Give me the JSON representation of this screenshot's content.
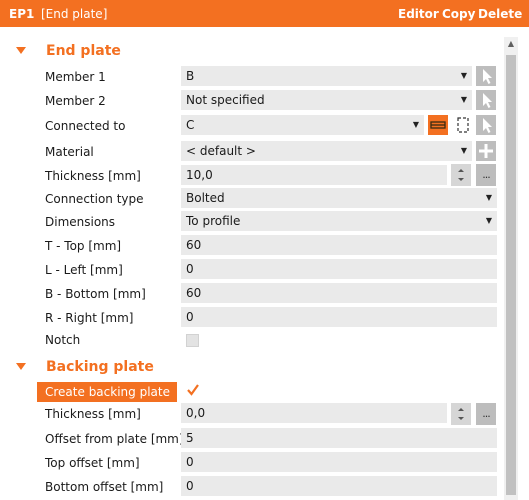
{
  "header": {
    "code": "EP1",
    "name": "[End plate]",
    "actions": {
      "editor": "Editor",
      "copy": "Copy",
      "delete": "Delete"
    }
  },
  "end_plate": {
    "title": "End plate",
    "member1": {
      "label": "Member 1",
      "value": "B"
    },
    "member2": {
      "label": "Member 2",
      "value": "Not specified"
    },
    "connected_to": {
      "label": "Connected to",
      "value": "C"
    },
    "material": {
      "label": "Material",
      "value": "< default >"
    },
    "thickness": {
      "label": "Thickness [mm]",
      "value": "10,0"
    },
    "connection_type": {
      "label": "Connection type",
      "value": "Bolted"
    },
    "dimensions": {
      "label": "Dimensions",
      "value": "To profile"
    },
    "t_top": {
      "label": "T - Top [mm]",
      "value": "60"
    },
    "l_left": {
      "label": "L - Left [mm]",
      "value": "0"
    },
    "b_bottom": {
      "label": "B - Bottom [mm]",
      "value": "60"
    },
    "r_right": {
      "label": "R - Right [mm]",
      "value": "0"
    },
    "notch": {
      "label": "Notch",
      "checked": false
    }
  },
  "backing_plate": {
    "title": "Backing plate",
    "create": {
      "label": "Create backing plate",
      "checked": true
    },
    "thickness": {
      "label": "Thickness [mm]",
      "value": "0,0"
    },
    "offset_from_plate": {
      "label": "Offset from plate [mm]",
      "value": "5"
    },
    "top_offset": {
      "label": "Top offset [mm]",
      "value": "0"
    },
    "bottom_offset": {
      "label": "Bottom offset [mm]",
      "value": "0"
    }
  },
  "icons": {
    "pick": "cursor-arrow-icon",
    "add": "plus-icon",
    "spin": "spinner-icon",
    "more": "ellipsis-icon",
    "link": "link-members-icon",
    "frame": "frame-icon"
  },
  "colors": {
    "accent": "#f37021",
    "field_bg": "#eaeaea",
    "button_bg": "#bdbdbd"
  }
}
